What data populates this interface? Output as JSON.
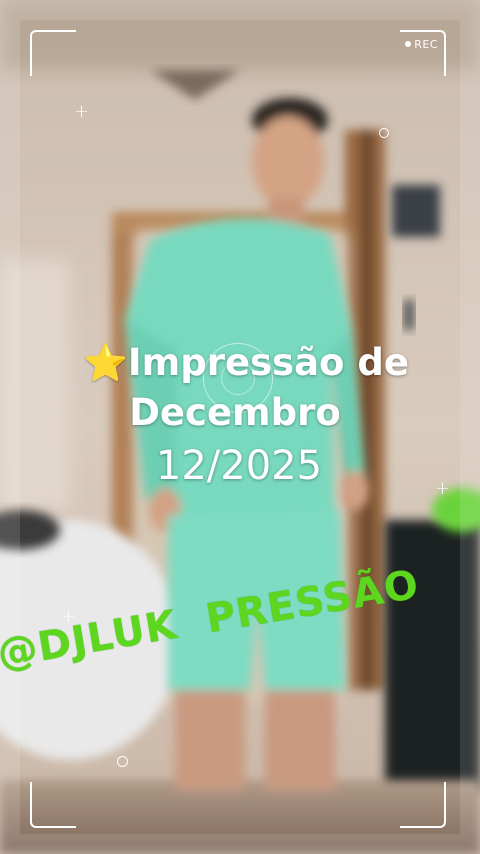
{
  "overlay": {
    "rec_label": "REC"
  },
  "caption": {
    "star_icon": "⭐",
    "line1": "Impressão de",
    "line2": "Decembro",
    "line3": "12/2025"
  },
  "watermark": {
    "text": "@DJLUK  PRESSÃO",
    "color": "#5cd61e"
  },
  "colors": {
    "frame": "#ffffff",
    "scrubs": "#78d9bf"
  }
}
